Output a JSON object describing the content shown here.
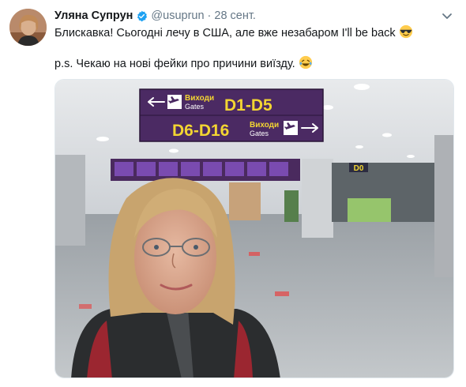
{
  "tweet": {
    "author_name": "Уляна Супрун",
    "handle": "@usuprun",
    "separator": "·",
    "date": "28 сент.",
    "text_line1": "Блискавка! Сьогодні лечу в США, але вже незабаром I'll be back",
    "text_line2": "p.s. Чекаю на нові фейки про причини виїзду.",
    "emoji1": "sunglasses-emoji",
    "emoji2": "laughing-tears-emoji"
  },
  "photo": {
    "sign_top_word1": "Виходи",
    "sign_top_word2": "Gates",
    "sign_top_gates": "D1-D5",
    "sign_bottom_gates": "D6-D16",
    "sign_bottom_word1": "Виходи",
    "sign_bottom_word2": "Gates",
    "far_sign": "D0"
  },
  "colors": {
    "verified": "#1da1f2",
    "sign_purple": "#4b2a63",
    "sign_yellow": "#f3d532",
    "muted_text": "#657786"
  }
}
